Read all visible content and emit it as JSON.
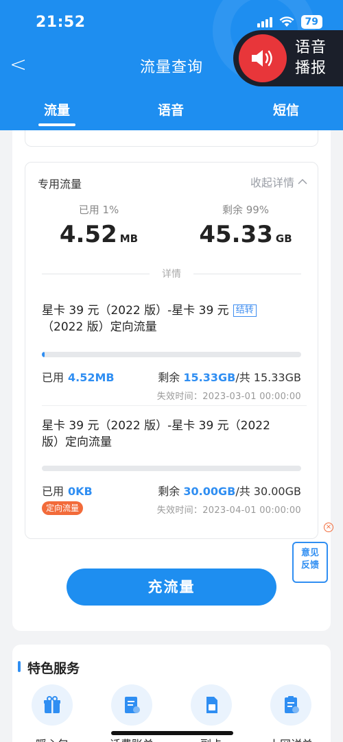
{
  "status_bar": {
    "time": "21:52",
    "battery": "79"
  },
  "header": {
    "title": "流量查询",
    "back_label": "<"
  },
  "tabs": [
    {
      "label": "流量",
      "active": true
    },
    {
      "label": "语音",
      "active": false
    },
    {
      "label": "短信",
      "active": false
    }
  ],
  "voice_broadcast": {
    "line1": "语音",
    "line2": "播报",
    "icon": "speaker-icon"
  },
  "flow_card": {
    "title": "专用流量",
    "collapse_label": "收起详情",
    "used_label": "已用 1%",
    "used_value": "4.52",
    "used_unit": "MB",
    "remain_label": "剩余 99%",
    "remain_value": "45.33",
    "remain_unit": "GB",
    "divider_label": "详情"
  },
  "packages": [
    {
      "name_line1": "星卡 39 元（2022 版）-星卡 39 元",
      "name_line2": "（2022 版）定向流量",
      "tag": "结转",
      "progress_fraction": 0.003,
      "used_prefix": "已用",
      "used": "4.52MB",
      "remain_prefix": "剩余",
      "remain": "15.33GB",
      "total": "/共 15.33GB",
      "expire": "失效时间：2023-03-01 00:00:00"
    },
    {
      "name_line1": "星卡 39 元（2022 版）-星卡 39 元（2022",
      "name_line2": "版）定向流量",
      "tag": "定向流量",
      "progress_fraction": 0,
      "used_prefix": "已用",
      "used": "0KB",
      "remain_prefix": "剩余",
      "remain": "30.00GB",
      "total": "/共 30.00GB",
      "expire": "失效时间：2023-04-01 00:00:00"
    }
  ],
  "recharge_button": "充流量",
  "feedback": {
    "line1": "意见",
    "line2": "反馈"
  },
  "services": {
    "title": "特色服务",
    "items": [
      {
        "label": "暖心包",
        "icon": "gift-icon"
      },
      {
        "label": "话费账单",
        "icon": "bill-icon"
      },
      {
        "label": "副卡",
        "icon": "sim-card-icon"
      },
      {
        "label": "上网详单",
        "icon": "detail-list-icon"
      }
    ]
  },
  "colors": {
    "primary": "#1e8ef0",
    "accent_red": "#e8363a",
    "tag_orange": "#f26b3a"
  }
}
